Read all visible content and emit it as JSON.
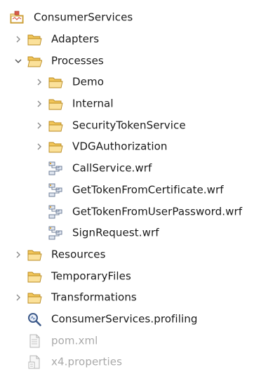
{
  "tree": {
    "root": {
      "label": "ConsumerServices",
      "icon": "project-icon"
    },
    "items": [
      {
        "label": "Adapters",
        "icon": "folder-icon",
        "twisty": "collapsed"
      },
      {
        "label": "Processes",
        "icon": "folder-icon",
        "twisty": "expanded"
      },
      {
        "label": "Demo",
        "icon": "folder-icon",
        "twisty": "collapsed"
      },
      {
        "label": "Internal",
        "icon": "folder-icon",
        "twisty": "collapsed"
      },
      {
        "label": "SecurityTokenService",
        "icon": "folder-icon",
        "twisty": "collapsed"
      },
      {
        "label": "VDGAuthorization",
        "icon": "folder-icon",
        "twisty": "collapsed"
      },
      {
        "label": "CallService.wrf",
        "icon": "workflow-file-icon"
      },
      {
        "label": "GetTokenFromCertificate.wrf",
        "icon": "workflow-file-icon"
      },
      {
        "label": "GetTokenFromUserPassword.wrf",
        "icon": "workflow-file-icon"
      },
      {
        "label": "SignRequest.wrf",
        "icon": "workflow-file-icon"
      },
      {
        "label": "Resources",
        "icon": "folder-icon",
        "twisty": "collapsed"
      },
      {
        "label": "TemporaryFiles",
        "icon": "folder-icon"
      },
      {
        "label": "Transformations",
        "icon": "folder-icon",
        "twisty": "collapsed"
      },
      {
        "label": "ConsumerServices.profiling",
        "icon": "profiling-search-icon"
      },
      {
        "label": "pom.xml",
        "icon": "text-file-icon"
      },
      {
        "label": "x4.properties",
        "icon": "properties-file-icon"
      }
    ]
  },
  "colors": {
    "folder_fill": "#f6d47a",
    "folder_stroke": "#c99a2e",
    "twisty": "#7a7a7a",
    "dim_text": "#a9a9a9",
    "workflow_accent": "#6f7f9a"
  }
}
